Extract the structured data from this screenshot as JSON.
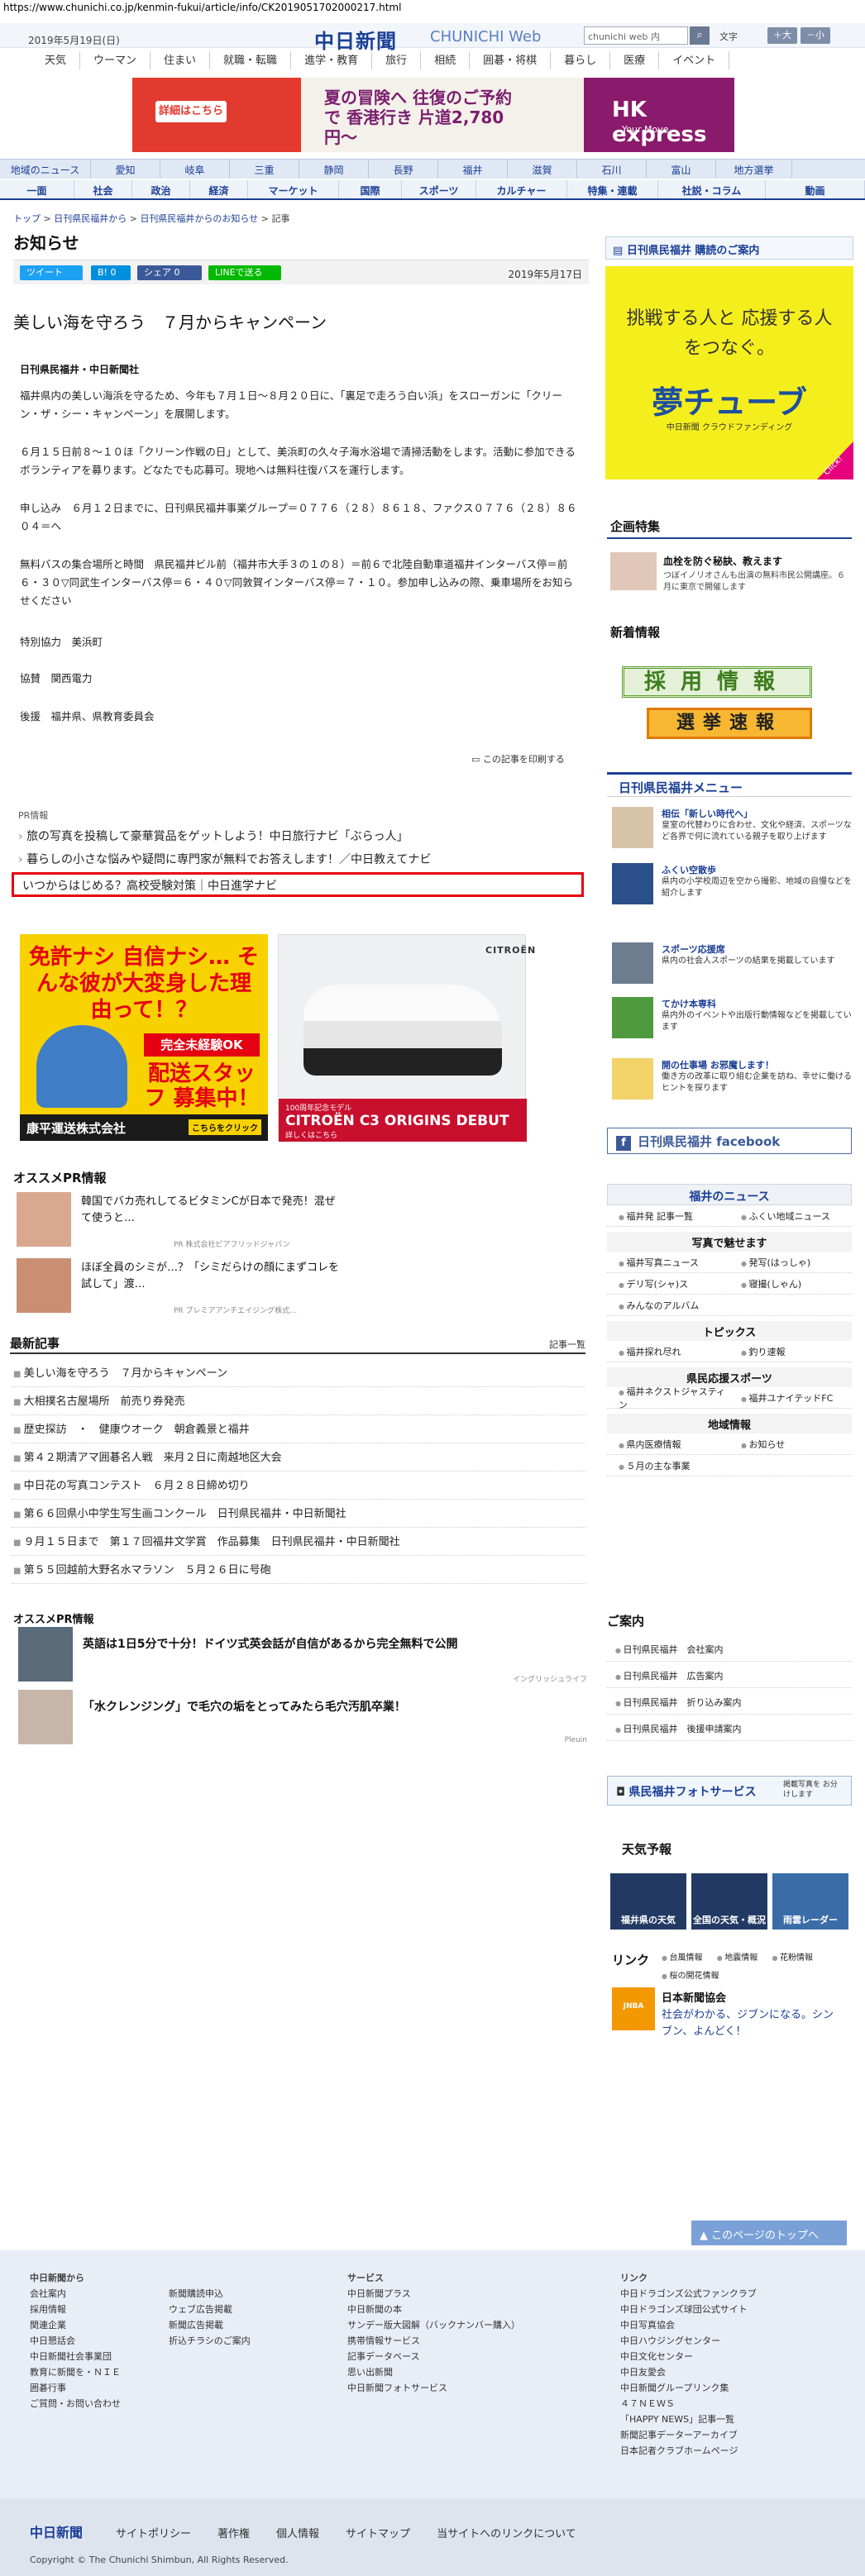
{
  "url": "https://www.chunichi.co.jp/kenmin-fukui/article/info/CK2019051702000217.html",
  "header": {
    "date": "2019年5月19日(日)",
    "logo_main": "中日新聞",
    "logo_sub": "CHUNICHI Web",
    "search_placeholder": "chunichi web 内",
    "font_label": "文字",
    "font_large": "＋大",
    "font_small": "－小"
  },
  "global_nav": [
    "天気",
    "ウーマン",
    "住まい",
    "就職・転職",
    "進学・教育",
    "旅行",
    "相続",
    "囲碁・将棋",
    "暮らし",
    "医療",
    "イベント"
  ],
  "banner": {
    "detail": "詳細はこちら",
    "headline": "夏の冒険へ 往復のご予約で 香港行き 片道2,780円〜",
    "brand": "HK express",
    "brand_sub": "Your Move"
  },
  "region_nav": [
    "地域のニュース",
    "愛知",
    "岐阜",
    "三重",
    "静岡",
    "長野",
    "福井",
    "滋賀",
    "石川",
    "富山",
    "地方選挙"
  ],
  "category_nav": [
    "一面",
    "社会",
    "政治",
    "経済",
    "マーケット",
    "国際",
    "スポーツ",
    "カルチャー",
    "特集・連載",
    "社説・コラム",
    "動画"
  ],
  "breadcrumb": [
    "トップ",
    "日刊県民福井から",
    "日刊県民福井からのお知らせ",
    "記事"
  ],
  "section_title": "お知らせ",
  "share": {
    "tweet": "ツイート",
    "hatena": "B! 0",
    "fb": "シェア 0",
    "line": "LINEで送る"
  },
  "article": {
    "date": "2019年5月17日",
    "title": "美しい海を守ろう　７月からキャンペーン",
    "byline": "日刊県民福井・中日新聞社",
    "paragraphs": [
      "福井県内の美しい海浜を守るため、今年も７月１日〜８月２０日に、「裏足で走ろう白い浜」をスローガンに「クリーン・ザ・シー・キャンペーン」を展開します。",
      "６月１５日前８〜１０ほ「クリーン作戦の日」として、美浜町の久々子海水浴場で清掃活動をします。活動に参加できるボランティアを募ります。どなたでも応募可。現地へは無料往復バスを運行します。",
      "申し込み　６月１２日までに、日刊県民福井事業グループ＝０７７６（２８）８６１８、ファクス０７７６（２８）８６０４＝へ",
      "無料バスの集合場所と時間　県民福井ビル前（福井市大手３の１の８）＝前６で北陸自動車道福井インターバス停＝前６・３０▽同武生インターバス停＝６・４０▽同敦賀インターバス停＝７・１０。参加申し込みの際、乗車場所をお知らせください",
      "特別協力　美浜町",
      "協賛　関西電力",
      "後援　福井県、県教育委員会"
    ],
    "print": "この記事を印刷する"
  },
  "pr": {
    "label": "PR情報",
    "links": [
      "旅の写真を投稿して豪華賞品をゲットしよう！中日旅行ナビ「ぶらっ人」",
      "暮らしの小さな悩みや疑問に専門家が無料でお答えします！／中日教えてナビ"
    ],
    "highlight": "いつからはじめる？高校受験対策｜中日進学ナビ"
  },
  "ad_left": {
    "headline": "免許ナシ 自信ナシ… そんな彼が大変身した理由って！？",
    "badge": "完全未経験OK",
    "cta": "配送スタッフ 募集中！",
    "company": "康平運送株式会社",
    "button": "こちらをクリック"
  },
  "ad_right": {
    "brand": "CITROËN",
    "note": "100周年記念モデル",
    "model": "CITROËN C3 ORIGINS DEBUT",
    "cta": "詳しくはこちら"
  },
  "osusume": {
    "heading": "オススメPR情報",
    "items": [
      {
        "text": "韓国でバカ売れしてるビタミンCが日本で発売！混ぜて使うと…",
        "sponsor": "PR 株式会社ビアフリッドジャパン"
      },
      {
        "text": "ほぼ全員のシミが…？「シミだらけの顔にまずコレを試して」渡…",
        "sponsor": "PR プレミアアンチエイジング株式…"
      }
    ]
  },
  "latest": {
    "heading": "最新記事",
    "more": "記事一覧",
    "items": [
      "美しい海を守ろう　７月からキャンペーン",
      "大相撲名古屋場所　前売り券発売",
      "歴史探訪　・　健康ウオーク　朝倉義景と福井",
      "第４２期清アマ囲碁名人戦　来月２日に南越地区大会",
      "中日花の写真コンテスト　６月２８日締め切り",
      "第６６回県小中学生写生画コンクール　日刊県民福井・中日新聞社",
      "９月１５日まで　第１７回福井文学賞　作品募集　日刊県民福井・中日新聞社",
      "第５５回越前大野名水マラソン　５月２６日に号砲"
    ]
  },
  "osusume2": {
    "heading": "オススメPR情報",
    "items": [
      {
        "text": "英語は1日5分で十分！ドイツ式英会話が自信があるから完全無料で公開",
        "sponsor": "イングリッシュライフ"
      },
      {
        "text": "「水クレンジング」で毛穴の垢をとってみたら毛穴汚肌卒業！",
        "sponsor": "Pleuin"
      }
    ]
  },
  "sidebar": {
    "subscribe": "日刊県民福井 購読のご案内",
    "yume": {
      "line1": "挑戦する人と 応援する人をつなぐ。",
      "logo": "夢チューブ",
      "sub": "中日新聞 クラウドファンディング",
      "click": "Click!"
    },
    "kikaku": {
      "heading": "企画特集",
      "title": "血栓を防ぐ秘訣、教えます",
      "desc": "つぼイノリオさんも出演の無料市民公開講座。６月に東京で開催します"
    },
    "shinchaku": "新着情報",
    "saiyo": "採用情報",
    "senkyo": "選挙速報",
    "menu_heading": "日刊県民福井メニュー",
    "menu": [
      {
        "title": "相伝「新しい時代へ」",
        "desc": "皇室の代替わりに合わせ、文化や経済、スポーツなど各界で何に流れている親子を取り上げます"
      },
      {
        "title": "ふくい空散歩",
        "desc": "県内の小学校周辺を空から撮影、地域の自慢などを紹介します"
      },
      {
        "title": "スポーツ応援席",
        "desc": "県内の社会人スポーツの結果を掲載しています"
      },
      {
        "title": "てかけ本専科",
        "desc": "県内外のイベントや出版行動情報などを掲載しています"
      },
      {
        "title": "開の仕事場 お邪魔します！",
        "desc": "働き方の改革に取り組む企業を訪ね、幸せに働けるヒントを探ります"
      }
    ],
    "facebook": "日刊県民福井 facebook",
    "fukui_news": {
      "heading": "福井のニュース",
      "row1": [
        "福井発 記事一覧",
        "ふくい地域ニュース"
      ],
      "photo_h": "写真で魅せます",
      "row2": [
        "福井写真ニュース",
        "発写(はっしゃ)"
      ],
      "row3": [
        "デリ写(シャ)ス",
        "寝撮(しゃん)"
      ],
      "row4": [
        "みんなのアルバム"
      ],
      "topics_h": "トピックス",
      "row5": [
        "福井探れ尽れ",
        "釣り速報"
      ],
      "sports_h": "県民応援スポーツ",
      "row6": [
        "福井ネクストジャスティン",
        "福井ユナイテッドFC"
      ],
      "local_h": "地域情報",
      "row7": [
        "県内医療情報",
        "お知らせ"
      ],
      "row8": [
        "５月の主な事業"
      ]
    },
    "goannai": {
      "heading": "ご案内",
      "items": [
        "日刊県民福井　会社案内",
        "日刊県民福井　広告案内",
        "日刊県民福井　折り込み案内",
        "日刊県民福井　後援申請案内"
      ]
    },
    "photo_service": "県民福井フォトサービス",
    "photo_note": "掲載写真を お分けします",
    "tenki": {
      "heading": "天気予報",
      "items": [
        "福井県の天気",
        "全国の天気・概況",
        "雨雲レーダー"
      ]
    },
    "link": {
      "heading": "リンク",
      "items": [
        "台風情報",
        "地震情報",
        "花粉情報",
        "桜の開花情報"
      ]
    },
    "jnba": {
      "name": "日本新聞協会",
      "desc": "社会がわかる、ジブンになる。シンブン、よんどく！",
      "mark": "JNBA"
    }
  },
  "pagetop": "このページのトップへ",
  "footer": {
    "col1_h": "中日新聞から",
    "col1": [
      "会社案内",
      "採用情報",
      "関連企業",
      "中日懇話会",
      "中日新聞社会事業団",
      "教育に新聞を・ＮＩＥ",
      "囲碁行事",
      "ご質問・お問い合わせ"
    ],
    "col2": [
      "新聞購読申込",
      "ウェブ広告掲載",
      "新聞広告掲載",
      "折込チラシのご案内"
    ],
    "col3_h": "サービス",
    "col3": [
      "中日新聞プラス",
      "中日新聞の本",
      "サンデー版大図解（バックナンバー購入）",
      "携帯情報サービス",
      "記事データベース",
      "思い出新聞",
      "中日新聞フォトサービス"
    ],
    "col4_h": "リンク",
    "col4": [
      "中日ドラゴンズ公式ファンクラブ",
      "中日ドラゴンズ球団公式サイト",
      "中日写真協会",
      "中日ハウジングセンター",
      "中日文化センター",
      "中日友愛会",
      "中日新聞グループリンク集",
      "４７ＮＥＷＳ",
      "「HAPPY NEWS」記事一覧",
      "新聞記事データーアーカイブ",
      "日本記者クラブホームページ"
    ],
    "nav": [
      "サイトポリシー",
      "著作権",
      "個人情報",
      "サイトマップ",
      "当サイトへのリンクについて"
    ],
    "logo": "中日新聞",
    "copyright": "Copyright © The Chunichi Shimbun, All Rights Reserved."
  }
}
